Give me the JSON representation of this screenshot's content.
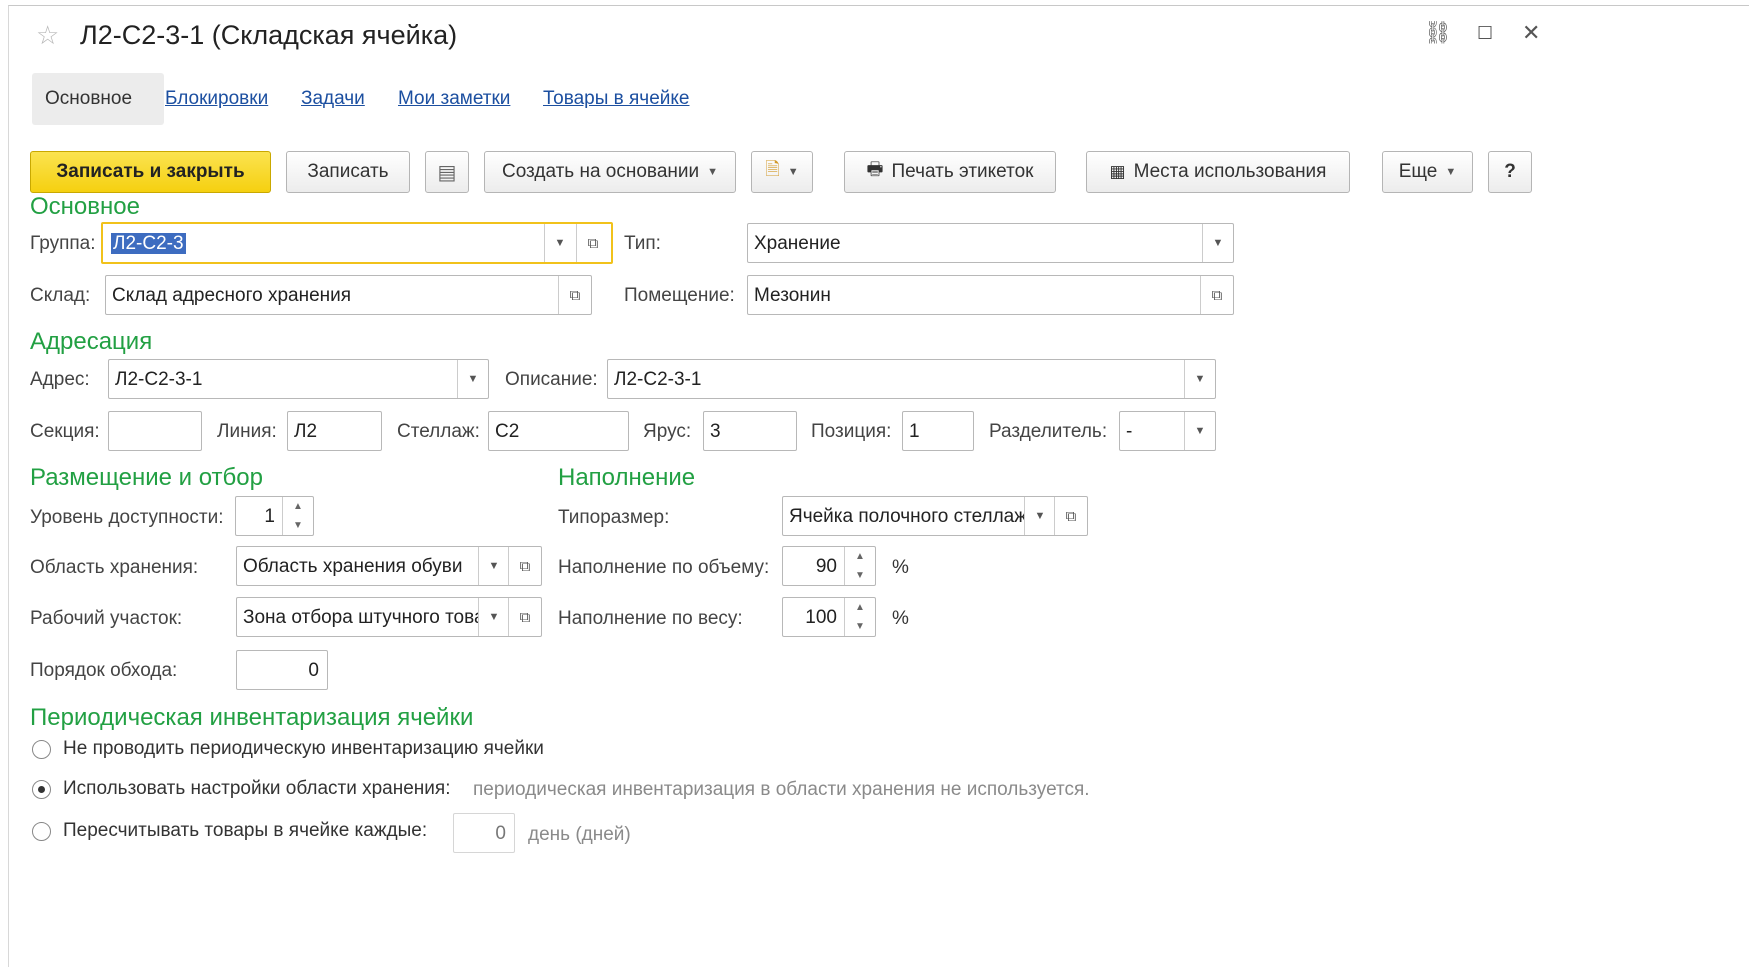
{
  "window": {
    "title": "Л2-С2-3-1 (Складская ячейка)"
  },
  "tabs": [
    "Основное",
    "Блокировки",
    "Задачи",
    "Мои заметки",
    "Товары в ячейке"
  ],
  "toolbar": {
    "save_close": "Записать и закрыть",
    "save": "Записать",
    "create_based": "Создать на основании",
    "print_labels": "Печать этикеток",
    "usage_places": "Места использования",
    "more": "Еще",
    "help": "?"
  },
  "main_section": {
    "heading": "Основное",
    "group_label": "Группа:",
    "group_value": "Л2-С2-3",
    "type_label": "Тип:",
    "type_value": "Хранение",
    "warehouse_label": "Склад:",
    "warehouse_value": "Склад адресного хранения",
    "room_label": "Помещение:",
    "room_value": "Мезонин"
  },
  "addressing": {
    "heading": "Адресация",
    "address_label": "Адрес:",
    "address_value": "Л2-С2-3-1",
    "description_label": "Описание:",
    "description_value": "Л2-С2-3-1",
    "section_label": "Секция:",
    "section_value": "",
    "line_label": "Линия:",
    "line_value": "Л2",
    "rack_label": "Стеллаж:",
    "rack_value": "С2",
    "tier_label": "Ярус:",
    "tier_value": "3",
    "position_label": "Позиция:",
    "position_value": "1",
    "separator_label": "Разделитель:",
    "separator_value": "-"
  },
  "placement": {
    "heading": "Размещение и отбор",
    "access_level_label": "Уровень доступности:",
    "access_level_value": "1",
    "storage_area_label": "Область хранения:",
    "storage_area_value": "Область хранения обуви",
    "work_area_label": "Рабочий участок:",
    "work_area_value": "Зона отбора штучного товара",
    "bypass_order_label": "Порядок обхода:",
    "bypass_order_value": "0"
  },
  "filling": {
    "heading": "Наполнение",
    "size_type_label": "Типоразмер:",
    "size_type_value": "Ячейка полочного стеллажа",
    "volume_label": "Наполнение по объему:",
    "volume_value": "90",
    "weight_label": "Наполнение по весу:",
    "weight_value": "100",
    "percent": "%"
  },
  "inventory": {
    "heading": "Периодическая инвентаризация ячейки",
    "option1": "Не проводить периодическую инвентаризацию ячейки",
    "option2": "Использовать настройки области хранения:",
    "option2_hint": "периодическая инвентаризация в области хранения не используется.",
    "option3": "Пересчитывать товары в ячейке каждые:",
    "days_value": "0",
    "days_unit": "день (дней)",
    "selected": 2
  }
}
